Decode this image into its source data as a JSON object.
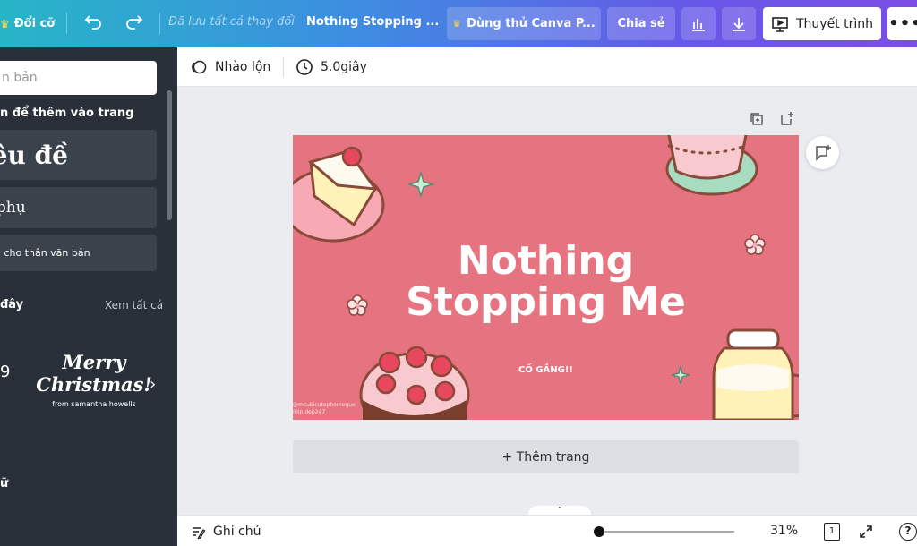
{
  "topbar": {
    "upgrade_label": "Đổi cỡ",
    "saved_status": "Đã lưu tất cả thay đổi",
    "doc_title": "Nothing Stopping ...",
    "try_pro_label": "Dùng thử Canva P...",
    "share_label": "Chia sẻ",
    "present_label": "Thuyết trình"
  },
  "sidebar": {
    "search_placeholder": "n bản",
    "add_heading": "n để thêm vào trang",
    "heading_card": "iêu đề",
    "subheading_card": "ề phụ",
    "body_card": "ung cho thân văn bản",
    "recent_heading": "đây",
    "see_all": "Xem tất cả",
    "sample_left": "9",
    "merry_line1": "Merry",
    "merry_line2": "Christmas!",
    "merry_credit": "from samantha howells",
    "bottom_heading": "ữ"
  },
  "toolbar": {
    "animate_label": "Nhào lộn",
    "duration_label": "5.0giây"
  },
  "slide": {
    "title_line1": "Nothing",
    "title_line2": "Stopping Me",
    "subtitle": "CỐ GẮNG!!",
    "credit": "@mcubicutephomeque\n@in.dep247",
    "background_color": "#e67480"
  },
  "canvas": {
    "add_page_label": "+ Thêm trang"
  },
  "bottombar": {
    "notes_label": "Ghi chú",
    "zoom_percent": "31%",
    "page_count": "1",
    "zoom_level": 0.31,
    "help_label": "?"
  }
}
